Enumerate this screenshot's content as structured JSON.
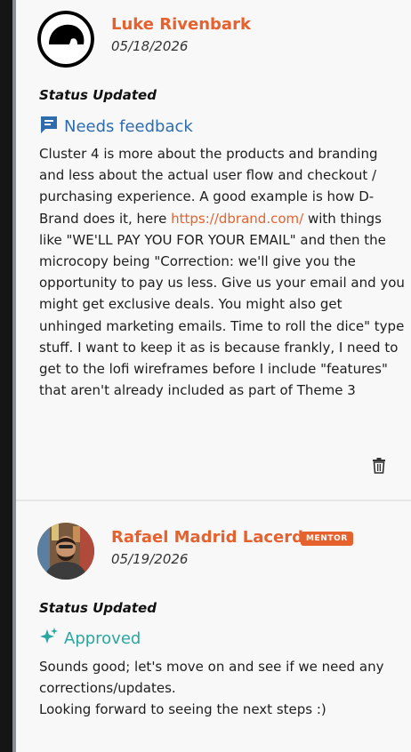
{
  "comments": [
    {
      "author": "Luke Rivenbark",
      "date": "05/18/2026",
      "status_heading": "Status Updated",
      "status": {
        "label": "Needs feedback",
        "icon": "feedback-icon",
        "color": "#2e6cae"
      },
      "body_part1": "Cluster 4 is more about the products and branding and less about the actual user flow and checkout / purchasing experience. A good example is how D-Brand does it, here ",
      "link_text": "https://dbrand.com/",
      "body_part2": " with things like \"WE'LL PAY YOU FOR YOUR EMAIL\" and then the microcopy being \"Correction: we'll give you the opportunity to pay us less. Give us your email and you might get exclusive deals. You might also get unhinged marketing emails. Time to roll the dice\" type stuff. I want to keep it as is because frankly, I need to get to the lofi wireframes before I include \"features\" that aren't already included as part of Theme 3",
      "actions": {
        "delete_icon": "trash-icon"
      }
    },
    {
      "author": "Rafael Madrid Lacerda",
      "badge": "MENTOR",
      "date": "05/19/2026",
      "status_heading": "Status Updated",
      "status": {
        "label": "Approved",
        "icon": "sparkles-icon",
        "color": "#2aa6a1"
      },
      "body_line1": "Sounds good; let's move on and see if we need any corrections/updates.",
      "body_line2": "Looking forward to seeing the next steps :)"
    }
  ]
}
